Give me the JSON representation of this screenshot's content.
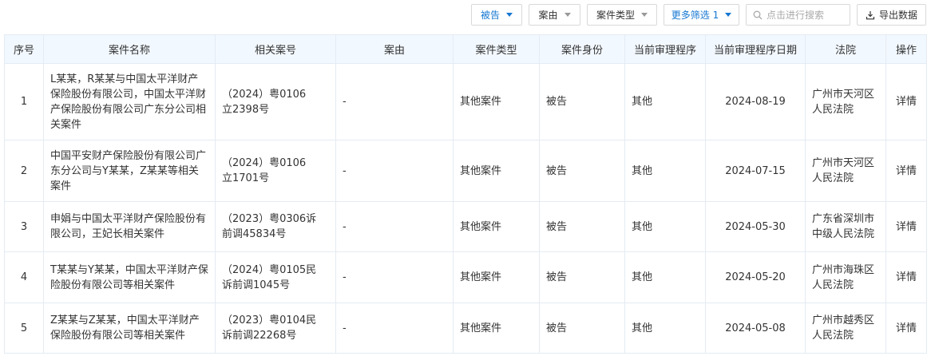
{
  "toolbar": {
    "role_filter": "被告",
    "cause_filter": "案由",
    "case_type_filter": "案件类型",
    "more_filter": "更多筛选 1",
    "search_placeholder": "点击进行搜索",
    "export_label": "导出数据"
  },
  "table": {
    "headers": [
      "序号",
      "案件名称",
      "相关案号",
      "案由",
      "案件类型",
      "案件身份",
      "当前审理程序",
      "当前审理程序日期",
      "法院",
      "操作"
    ],
    "rows": [
      {
        "idx": "1",
        "name": "L某某，R某某与中国太平洋财产保险股份有限公司，中国太平洋财产保险股份有限公司广东分公司相关案件",
        "case_no": "（2024）粤0106立2398号",
        "cause": "-",
        "type": "其他案件",
        "role": "被告",
        "procedure": "其他",
        "date": "2024-08-19",
        "court": "广州市天河区人民法院",
        "action": "详情"
      },
      {
        "idx": "2",
        "name": "中国平安财产保险股份有限公司广东分公司与Y某某，Z某某等相关案件",
        "case_no": "（2024）粤0106立1701号",
        "cause": "-",
        "type": "其他案件",
        "role": "被告",
        "procedure": "其他",
        "date": "2024-07-15",
        "court": "广州市天河区人民法院",
        "action": "详情"
      },
      {
        "idx": "3",
        "name": "申娟与中国太平洋财产保险股份有限公司，王妃长相关案件",
        "case_no": "（2023）粤0306诉前调45834号",
        "cause": "-",
        "type": "其他案件",
        "role": "被告",
        "procedure": "其他",
        "date": "2024-05-30",
        "court": "广东省深圳市中级人民法院",
        "action": "详情"
      },
      {
        "idx": "4",
        "name": "T某某与Y某某，中国太平洋财产保险股份有限公司等相关案件",
        "case_no": "（2024）粤0105民诉前调1045号",
        "cause": "-",
        "type": "其他案件",
        "role": "被告",
        "procedure": "其他",
        "date": "2024-05-20",
        "court": "广州市海珠区人民法院",
        "action": "详情"
      },
      {
        "idx": "5",
        "name": "Z某某与Z某某，中国太平洋财产保险股份有限公司等相关案件",
        "case_no": "（2023）粤0104民诉前调22268号",
        "cause": "-",
        "type": "其他案件",
        "role": "被告",
        "procedure": "其他",
        "date": "2024-05-08",
        "court": "广州市越秀区人民法院",
        "action": "详情"
      }
    ]
  }
}
